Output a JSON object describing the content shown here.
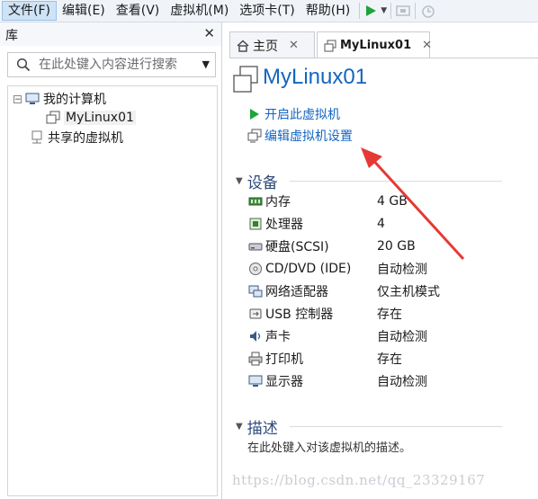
{
  "menu": {
    "items": [
      "文件(F)",
      "编辑(E)",
      "查看(V)",
      "虚拟机(M)",
      "选项卡(T)",
      "帮助(H)"
    ]
  },
  "toolbar": {
    "icons": [
      "play-icon",
      "dropdown-arrow-icon",
      "fullscreen-icon",
      "snapshot-icon"
    ],
    "accent": "#1fa33a"
  },
  "library": {
    "title": "库",
    "close": "✕",
    "search_placeholder": "在此处键入内容进行搜索",
    "tree": {
      "root_label": "我的计算机",
      "child_label": "MyLinux01",
      "shared_label": "共享的虚拟机"
    }
  },
  "tabs": [
    {
      "label": "主页",
      "close": "✕"
    },
    {
      "label": "MyLinux01",
      "close": "✕"
    }
  ],
  "vm": {
    "name": "MyLinux01",
    "actions": [
      {
        "label": "开启此虚拟机",
        "icon": "play-icon"
      },
      {
        "label": "编辑虚拟机设置",
        "icon": "vm-settings-icon"
      }
    ]
  },
  "devices": {
    "title": "设备",
    "items": [
      {
        "name": "内存",
        "value": "4 GB",
        "icon": "memory-icon"
      },
      {
        "name": "处理器",
        "value": "4",
        "icon": "cpu-icon"
      },
      {
        "name": "硬盘(SCSI)",
        "value": "20 GB",
        "icon": "harddisk-icon"
      },
      {
        "name": "CD/DVD (IDE)",
        "value": "自动检测",
        "icon": "cd-icon"
      },
      {
        "name": "网络适配器",
        "value": "仅主机模式",
        "icon": "network-icon"
      },
      {
        "name": "USB 控制器",
        "value": "存在",
        "icon": "usb-icon"
      },
      {
        "name": "声卡",
        "value": "自动检测",
        "icon": "sound-icon"
      },
      {
        "name": "打印机",
        "value": "存在",
        "icon": "printer-icon"
      },
      {
        "name": "显示器",
        "value": "自动检测",
        "icon": "monitor-icon"
      }
    ]
  },
  "description": {
    "title": "描述",
    "placeholder": "在此处键入对该虚拟机的描述。"
  },
  "watermark": "https://blog.csdn.net/qq_23329167",
  "colors": {
    "link_blue": "#1565c0",
    "annotation_red": "#e53935"
  }
}
